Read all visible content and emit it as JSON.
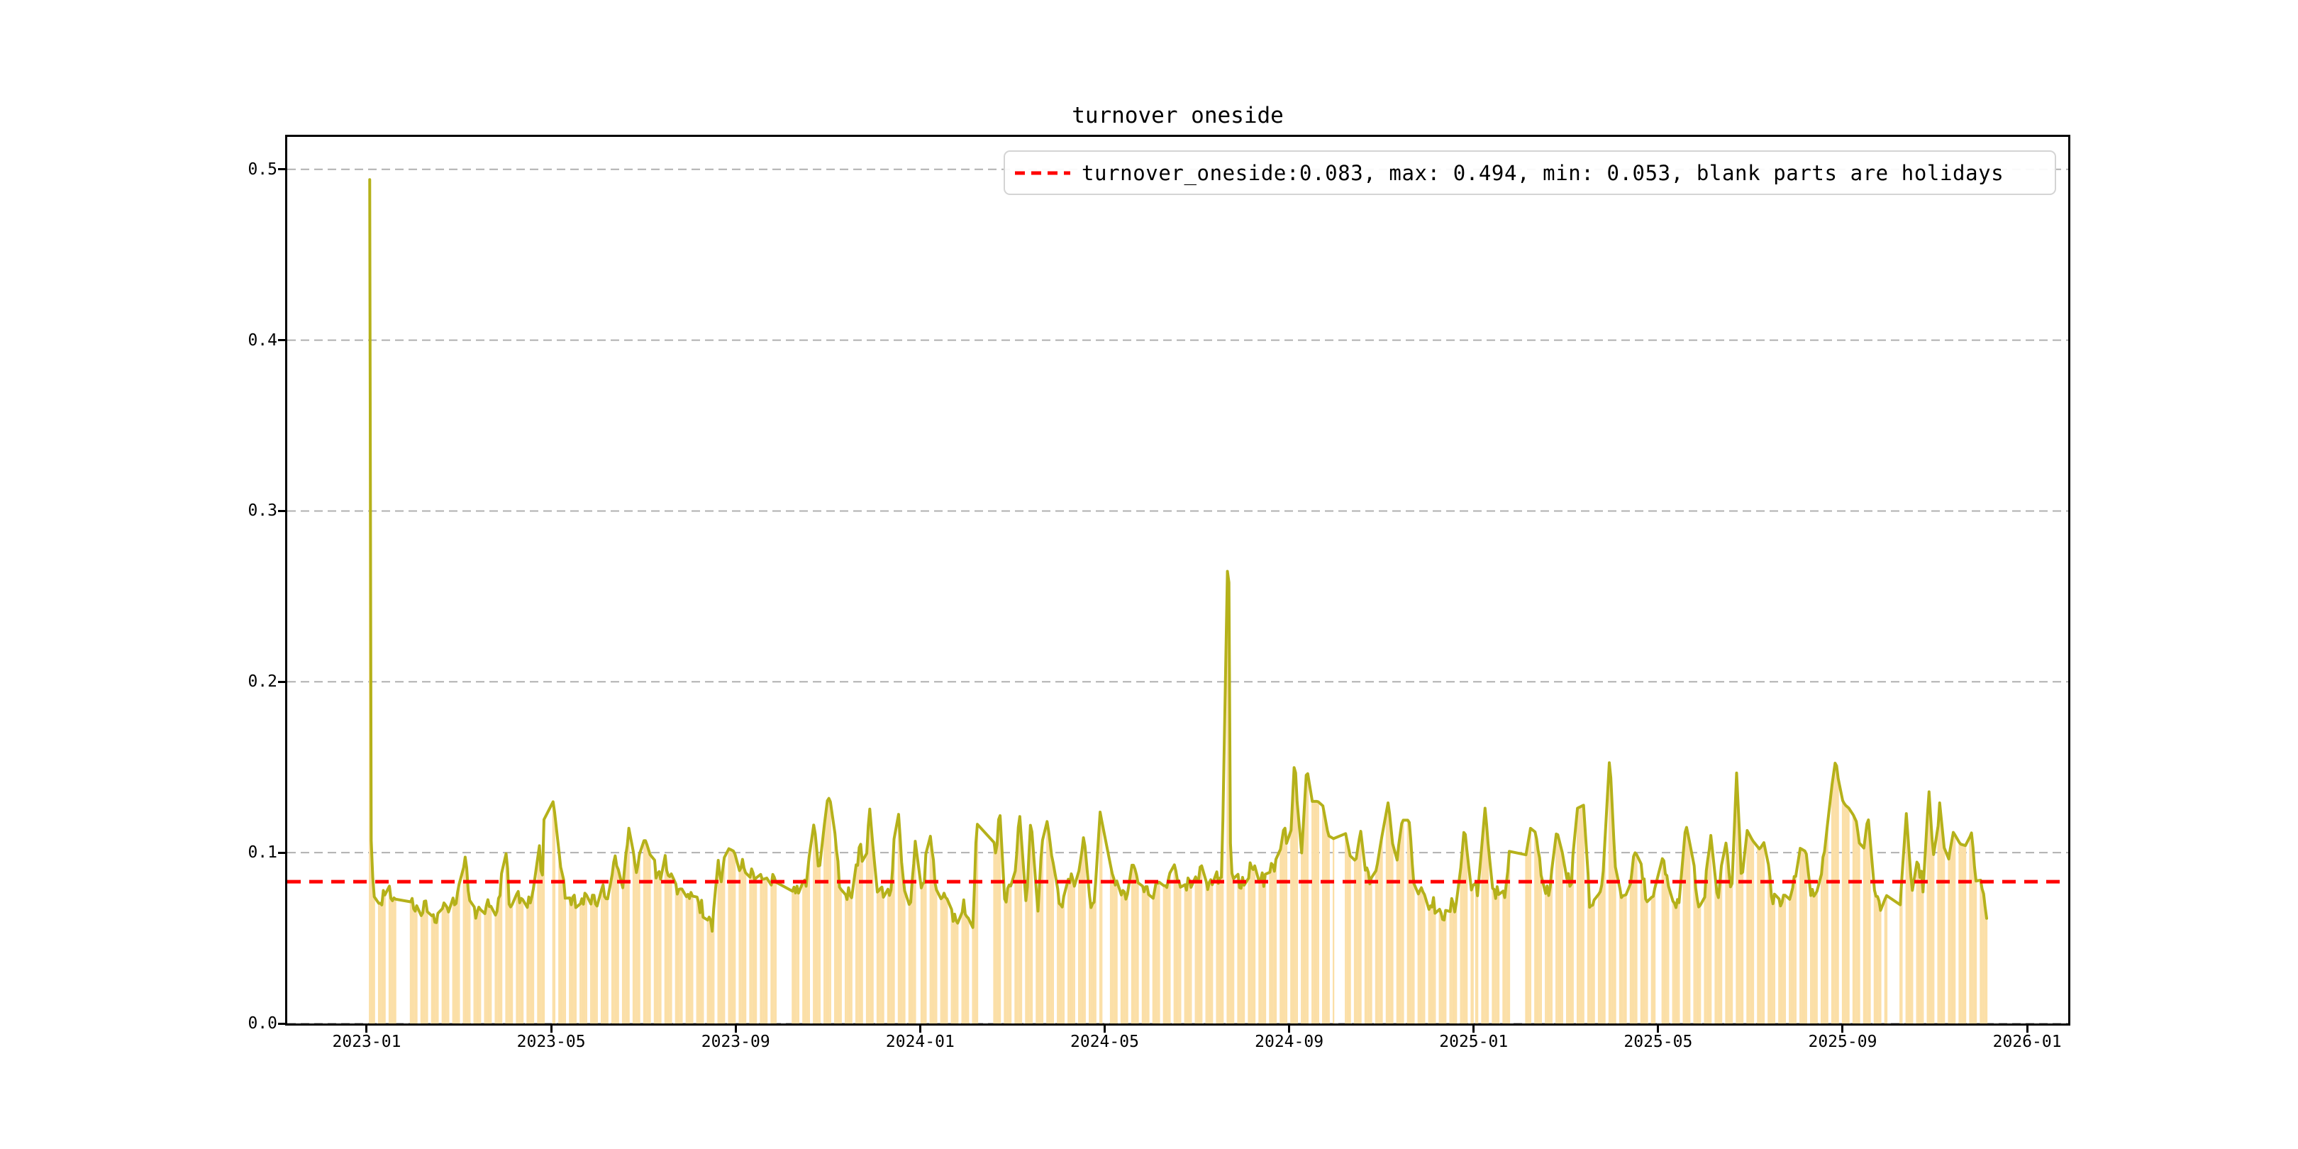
{
  "figure": {
    "title": "turnover oneside",
    "background": "#ffffff"
  },
  "legend": {
    "label": "turnover_oneside:0.083, max: 0.494, min: 0.053, blank parts are holidays",
    "sample_color": "#ff0000",
    "sample_style": "dashed"
  },
  "axes": {
    "ylim": [
      0,
      0.519
    ],
    "xlim_months": [
      -1.722,
      36.89
    ],
    "grid": true,
    "x_ticks": [
      {
        "m": 0,
        "label": "2023-01"
      },
      {
        "m": 4,
        "label": "2023-05"
      },
      {
        "m": 8,
        "label": "2023-09"
      },
      {
        "m": 12,
        "label": "2024-01"
      },
      {
        "m": 16,
        "label": "2024-05"
      },
      {
        "m": 20,
        "label": "2024-09"
      },
      {
        "m": 24,
        "label": "2025-01"
      },
      {
        "m": 28,
        "label": "2025-05"
      },
      {
        "m": 32,
        "label": "2025-09"
      },
      {
        "m": 36,
        "label": "2026-01"
      }
    ],
    "y_ticks": [
      {
        "v": 0.0,
        "label": "0.0"
      },
      {
        "v": 0.1,
        "label": "0.1"
      },
      {
        "v": 0.2,
        "label": "0.2"
      },
      {
        "v": 0.3,
        "label": "0.3"
      },
      {
        "v": 0.4,
        "label": "0.4"
      },
      {
        "v": 0.5,
        "label": "0.5"
      }
    ]
  },
  "chart_data": {
    "type": "line",
    "title": "turnover oneside",
    "x_unit": "months_since_2023-01-01",
    "ylabel": "",
    "xlabel": "",
    "stats": {
      "mean": 0.083,
      "max": 0.494,
      "min": 0.053
    },
    "mean_line": {
      "value": 0.083,
      "color": "#ff0000",
      "style": "dashed"
    },
    "grid_color": "#b0b0b0",
    "bars": {
      "color": "#fbdfa7",
      "note": "trading-day bars, height equals daily turnover, blank parts are holidays"
    },
    "data_start_month": 0.05,
    "data_end_month": 35.16,
    "jitter_amplitude": 0.005,
    "holidays_month_ranges": [
      [
        0.64,
        0.94
      ],
      [
        3.88,
        4.02
      ],
      [
        8.88,
        9.22
      ],
      [
        11.97,
        12.02
      ],
      [
        13.25,
        13.58
      ],
      [
        15.95,
        16.1
      ],
      [
        20.97,
        21.21
      ],
      [
        23.99,
        24.04
      ],
      [
        24.85,
        25.11
      ],
      [
        27.93,
        28.08
      ],
      [
        32.96,
        33.23
      ]
    ],
    "series": [
      {
        "name": "turnover_oneside",
        "color": "#b5b11a",
        "points": [
          [
            0.066,
            0.494
          ],
          [
            0.1,
            0.09
          ],
          [
            0.16,
            0.074
          ],
          [
            0.3,
            0.073
          ],
          [
            0.45,
            0.079
          ],
          [
            0.55,
            0.072
          ],
          [
            0.64,
            0.07
          ],
          [
            0.94,
            0.072
          ],
          [
            1.1,
            0.066
          ],
          [
            1.3,
            0.071
          ],
          [
            1.5,
            0.058
          ],
          [
            1.65,
            0.071
          ],
          [
            1.8,
            0.069
          ],
          [
            1.95,
            0.07
          ],
          [
            2.12,
            0.097
          ],
          [
            2.25,
            0.068
          ],
          [
            2.4,
            0.065
          ],
          [
            2.55,
            0.063
          ],
          [
            2.7,
            0.072
          ],
          [
            2.85,
            0.066
          ],
          [
            3.0,
            0.108
          ],
          [
            3.1,
            0.07
          ],
          [
            3.3,
            0.075
          ],
          [
            3.45,
            0.068
          ],
          [
            3.6,
            0.074
          ],
          [
            3.75,
            0.105
          ],
          [
            3.8,
            0.078
          ],
          [
            3.85,
            0.125
          ],
          [
            4.05,
            0.13
          ],
          [
            4.15,
            0.104
          ],
          [
            4.35,
            0.068
          ],
          [
            4.5,
            0.072
          ],
          [
            4.65,
            0.075
          ],
          [
            4.8,
            0.071
          ],
          [
            4.95,
            0.07
          ],
          [
            5.1,
            0.08
          ],
          [
            5.25,
            0.076
          ],
          [
            5.4,
            0.1
          ],
          [
            5.55,
            0.075
          ],
          [
            5.7,
            0.119
          ],
          [
            5.85,
            0.085
          ],
          [
            5.95,
            0.107
          ],
          [
            6.05,
            0.107
          ],
          [
            6.2,
            0.094
          ],
          [
            6.35,
            0.084
          ],
          [
            6.45,
            0.101
          ],
          [
            6.6,
            0.083
          ],
          [
            6.7,
            0.081
          ],
          [
            6.85,
            0.077
          ],
          [
            7.0,
            0.074
          ],
          [
            7.15,
            0.071
          ],
          [
            7.3,
            0.067
          ],
          [
            7.42,
            0.064
          ],
          [
            7.48,
            0.054
          ],
          [
            7.6,
            0.095
          ],
          [
            7.7,
            0.083
          ],
          [
            7.8,
            0.103
          ],
          [
            7.95,
            0.101
          ],
          [
            8.1,
            0.093
          ],
          [
            8.25,
            0.088
          ],
          [
            8.4,
            0.086
          ],
          [
            8.55,
            0.084
          ],
          [
            8.7,
            0.083
          ],
          [
            8.88,
            0.086
          ],
          [
            9.22,
            0.075
          ],
          [
            9.4,
            0.079
          ],
          [
            9.55,
            0.083
          ],
          [
            9.7,
            0.118
          ],
          [
            9.8,
            0.09
          ],
          [
            10.0,
            0.133
          ],
          [
            10.1,
            0.127
          ],
          [
            10.25,
            0.082
          ],
          [
            10.4,
            0.076
          ],
          [
            10.55,
            0.074
          ],
          [
            10.7,
            0.108
          ],
          [
            10.8,
            0.079
          ],
          [
            10.9,
            0.128
          ],
          [
            11.05,
            0.08
          ],
          [
            11.2,
            0.075
          ],
          [
            11.35,
            0.074
          ],
          [
            11.5,
            0.135
          ],
          [
            11.65,
            0.076
          ],
          [
            11.8,
            0.073
          ],
          [
            11.9,
            0.109
          ],
          [
            12.05,
            0.077
          ],
          [
            12.2,
            0.115
          ],
          [
            12.35,
            0.078
          ],
          [
            12.5,
            0.072
          ],
          [
            12.65,
            0.066
          ],
          [
            12.8,
            0.061
          ],
          [
            12.9,
            0.07
          ],
          [
            13.0,
            0.065
          ],
          [
            13.1,
            0.058
          ],
          [
            13.15,
            0.053
          ],
          [
            13.22,
            0.117
          ],
          [
            13.58,
            0.11
          ],
          [
            13.65,
            0.097
          ],
          [
            13.72,
            0.128
          ],
          [
            13.85,
            0.066
          ],
          [
            13.95,
            0.085
          ],
          [
            14.0,
            0.057
          ],
          [
            14.15,
            0.125
          ],
          [
            14.3,
            0.069
          ],
          [
            14.4,
            0.121
          ],
          [
            14.55,
            0.064
          ],
          [
            14.7,
            0.127
          ],
          [
            14.8,
            0.11
          ],
          [
            14.95,
            0.075
          ],
          [
            15.1,
            0.072
          ],
          [
            15.25,
            0.087
          ],
          [
            15.4,
            0.076
          ],
          [
            15.55,
            0.111
          ],
          [
            15.7,
            0.064
          ],
          [
            15.8,
            0.078
          ],
          [
            15.9,
            0.124
          ],
          [
            16.12,
            0.092
          ],
          [
            16.3,
            0.08
          ],
          [
            16.45,
            0.076
          ],
          [
            16.6,
            0.09
          ],
          [
            16.75,
            0.082
          ],
          [
            16.9,
            0.08
          ],
          [
            17.05,
            0.078
          ],
          [
            17.2,
            0.088
          ],
          [
            17.35,
            0.08
          ],
          [
            17.5,
            0.093
          ],
          [
            17.65,
            0.078
          ],
          [
            17.8,
            0.084
          ],
          [
            17.95,
            0.08
          ],
          [
            18.1,
            0.09
          ],
          [
            18.25,
            0.082
          ],
          [
            18.4,
            0.086
          ],
          [
            18.55,
            0.084
          ],
          [
            18.62,
            0.273
          ],
          [
            18.7,
            0.257
          ],
          [
            18.73,
            0.09
          ],
          [
            18.9,
            0.085
          ],
          [
            19.05,
            0.082
          ],
          [
            19.2,
            0.095
          ],
          [
            19.35,
            0.083
          ],
          [
            19.5,
            0.086
          ],
          [
            19.65,
            0.092
          ],
          [
            19.8,
            0.1
          ],
          [
            19.9,
            0.117
          ],
          [
            20.0,
            0.09
          ],
          [
            20.12,
            0.157
          ],
          [
            20.25,
            0.09
          ],
          [
            20.38,
            0.15
          ],
          [
            20.5,
            0.13
          ],
          [
            20.6,
            0.13
          ],
          [
            20.72,
            0.129
          ],
          [
            20.85,
            0.11
          ],
          [
            20.95,
            0.108
          ],
          [
            21.21,
            0.113
          ],
          [
            21.4,
            0.088
          ],
          [
            21.55,
            0.113
          ],
          [
            21.7,
            0.085
          ],
          [
            21.85,
            0.083
          ],
          [
            22.0,
            0.108
          ],
          [
            22.15,
            0.13
          ],
          [
            22.3,
            0.09
          ],
          [
            22.45,
            0.119
          ],
          [
            22.6,
            0.119
          ],
          [
            22.75,
            0.072
          ],
          [
            22.9,
            0.082
          ],
          [
            23.05,
            0.068
          ],
          [
            23.2,
            0.07
          ],
          [
            23.35,
            0.065
          ],
          [
            23.5,
            0.07
          ],
          [
            23.65,
            0.068
          ],
          [
            23.8,
            0.116
          ],
          [
            23.95,
            0.075
          ],
          [
            24.1,
            0.08
          ],
          [
            24.25,
            0.127
          ],
          [
            24.4,
            0.075
          ],
          [
            24.55,
            0.08
          ],
          [
            24.7,
            0.075
          ],
          [
            24.8,
            0.106
          ],
          [
            24.85,
            0.073
          ],
          [
            25.11,
            0.095
          ],
          [
            25.25,
            0.117
          ],
          [
            25.35,
            0.111
          ],
          [
            25.5,
            0.08
          ],
          [
            25.65,
            0.078
          ],
          [
            25.8,
            0.113
          ],
          [
            25.95,
            0.097
          ],
          [
            26.1,
            0.08
          ],
          [
            26.25,
            0.126
          ],
          [
            26.4,
            0.128
          ],
          [
            26.52,
            0.062
          ],
          [
            26.65,
            0.072
          ],
          [
            26.8,
            0.085
          ],
          [
            26.95,
            0.157
          ],
          [
            27.08,
            0.085
          ],
          [
            27.2,
            0.078
          ],
          [
            27.35,
            0.074
          ],
          [
            27.5,
            0.1
          ],
          [
            27.62,
            0.096
          ],
          [
            27.75,
            0.072
          ],
          [
            27.9,
            0.077
          ],
          [
            28.1,
            0.093
          ],
          [
            28.3,
            0.072
          ],
          [
            28.45,
            0.07
          ],
          [
            28.6,
            0.117
          ],
          [
            28.72,
            0.101
          ],
          [
            28.85,
            0.072
          ],
          [
            29.0,
            0.075
          ],
          [
            29.15,
            0.112
          ],
          [
            29.3,
            0.075
          ],
          [
            29.45,
            0.11
          ],
          [
            29.6,
            0.078
          ],
          [
            29.7,
            0.147
          ],
          [
            29.82,
            0.08
          ],
          [
            29.93,
            0.113
          ],
          [
            30.05,
            0.107
          ],
          [
            30.2,
            0.102
          ],
          [
            30.32,
            0.107
          ],
          [
            30.45,
            0.075
          ],
          [
            30.6,
            0.07
          ],
          [
            30.75,
            0.078
          ],
          [
            30.9,
            0.074
          ],
          [
            31.05,
            0.103
          ],
          [
            31.18,
            0.101
          ],
          [
            31.3,
            0.078
          ],
          [
            31.45,
            0.074
          ],
          [
            31.6,
            0.099
          ],
          [
            31.75,
            0.136
          ],
          [
            31.85,
            0.155
          ],
          [
            31.95,
            0.133
          ],
          [
            32.05,
            0.128
          ],
          [
            32.18,
            0.125
          ],
          [
            32.3,
            0.118
          ],
          [
            32.42,
            0.094
          ],
          [
            32.55,
            0.122
          ],
          [
            32.7,
            0.075
          ],
          [
            32.85,
            0.07
          ],
          [
            32.96,
            0.072
          ],
          [
            33.23,
            0.063
          ],
          [
            33.38,
            0.123
          ],
          [
            33.5,
            0.078
          ],
          [
            33.62,
            0.095
          ],
          [
            33.75,
            0.08
          ],
          [
            33.87,
            0.137
          ],
          [
            34.0,
            0.082
          ],
          [
            34.1,
            0.13
          ],
          [
            34.25,
            0.09
          ],
          [
            34.4,
            0.112
          ],
          [
            34.55,
            0.105
          ],
          [
            34.68,
            0.104
          ],
          [
            34.8,
            0.112
          ],
          [
            34.9,
            0.078
          ],
          [
            35.0,
            0.08
          ],
          [
            35.1,
            0.064
          ],
          [
            35.15,
            0.065
          ]
        ]
      }
    ]
  }
}
